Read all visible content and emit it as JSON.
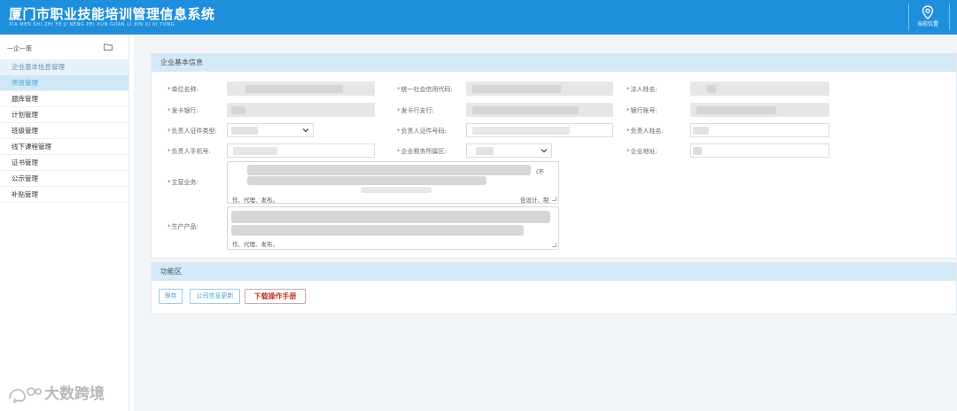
{
  "header": {
    "title": "厦门市职业技能培训管理信息系统",
    "subtitle": "XIA MEN SHI ZHI YE JI NENG PEI XUN GUAN LI XIN XI XI TONG",
    "location_label": "当前位置",
    "bg_color": "#1e8fdc"
  },
  "sidebar": {
    "head_label": "一企一策",
    "items": [
      {
        "label": "企业基本信息管理",
        "state": "selected-dim"
      },
      {
        "label": "师资管理",
        "state": "selected"
      },
      {
        "label": "题库管理",
        "state": ""
      },
      {
        "label": "计划管理",
        "state": ""
      },
      {
        "label": "班级管理",
        "state": ""
      },
      {
        "label": "线下课程管理",
        "state": ""
      },
      {
        "label": "证书管理",
        "state": ""
      },
      {
        "label": "公示管理",
        "state": ""
      },
      {
        "label": "补贴管理",
        "state": ""
      }
    ]
  },
  "basic_info": {
    "section_title": "企业基本信息",
    "labels": {
      "company_name": "单位名称:",
      "credit_code": "统一社会信用代码:",
      "legal_name": "法人姓名:",
      "issuing_bank": "发卡银行:",
      "issuing_branch": "发卡行支行:",
      "bank_account": "银行账号:",
      "id_type": "负责人证件类型:",
      "id_number": "负责人证件号码:",
      "person_name": "负责人姓名:",
      "phone": "负责人手机号:",
      "district": "企业税务所属区:",
      "address": "企业地址:",
      "main_business": "主营业务:",
      "products": "生产产品:"
    },
    "main_business_tail": "作、代理、发布。",
    "main_business_fragment_1": "(不",
    "main_business_fragment_2": "告设计、制",
    "products_tail": "作、代理、发布。",
    "required_mark": "*"
  },
  "functions": {
    "section_title": "功能区",
    "buttons": {
      "save": "保存",
      "sync": "公司信息更新",
      "download_manual": "下载操作手册"
    }
  },
  "watermark": {
    "text": "大数跨境"
  }
}
